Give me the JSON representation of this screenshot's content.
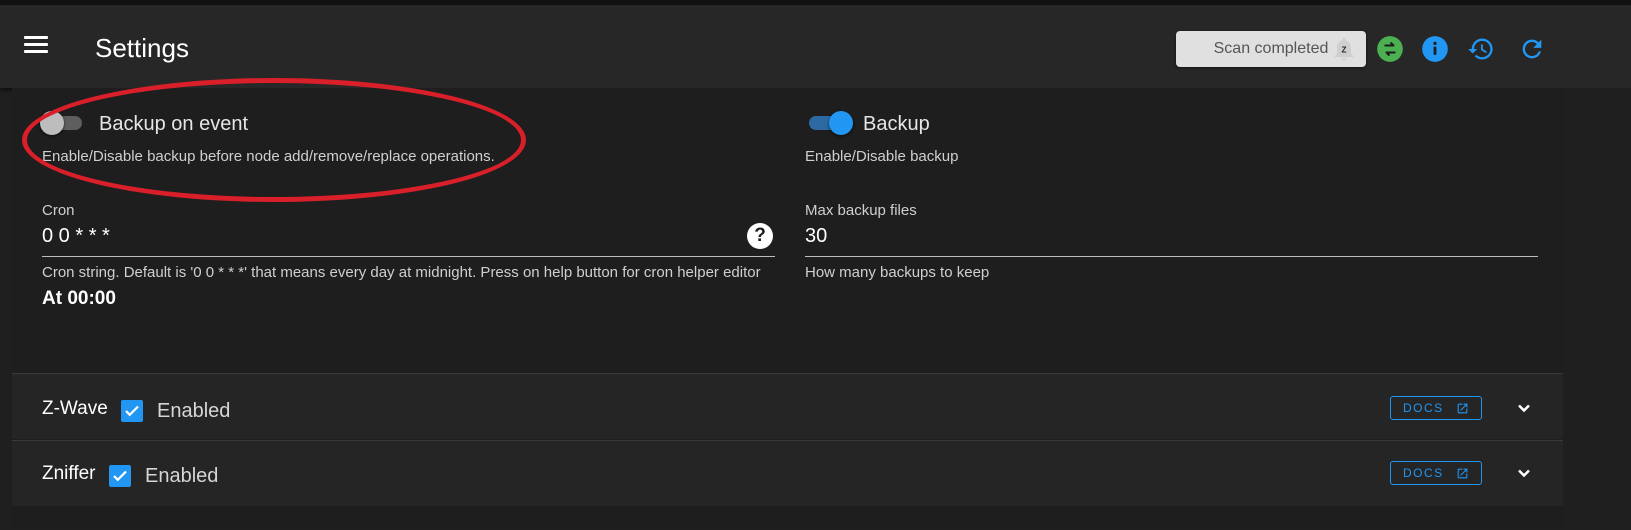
{
  "header": {
    "menu_icon": "menu-icon",
    "title": "Settings",
    "scan_status": "Scan completed",
    "icons": [
      "notification-icon",
      "sync-icon",
      "info-icon",
      "history-icon",
      "refresh-icon"
    ],
    "notification_badge": "Z"
  },
  "backup_on_event": {
    "label": "Backup on event",
    "enabled": false,
    "hint": "Enable/Disable backup before node add/remove/replace operations."
  },
  "backup": {
    "label": "Backup",
    "enabled": true,
    "hint": "Enable/Disable backup"
  },
  "cron": {
    "label": "Cron",
    "value": "0 0 * * *",
    "hint": "Cron string. Default is '0 0 * * *' that means every day at midnight. Press on help button for cron helper editor",
    "description": "At 00:00",
    "help_icon": "?"
  },
  "max_backup_files": {
    "label": "Max backup files",
    "value": "30",
    "hint": "How many backups to keep"
  },
  "panels": [
    {
      "title": "Z-Wave",
      "enabled_label": "Enabled",
      "checked": true,
      "docs_label": "DOCS"
    },
    {
      "title": "Zniffer",
      "enabled_label": "Enabled",
      "checked": true,
      "docs_label": "DOCS"
    }
  ],
  "colors": {
    "accent": "#2196f3",
    "annotation": "#d9202a",
    "sync_green": "#4caf50"
  }
}
